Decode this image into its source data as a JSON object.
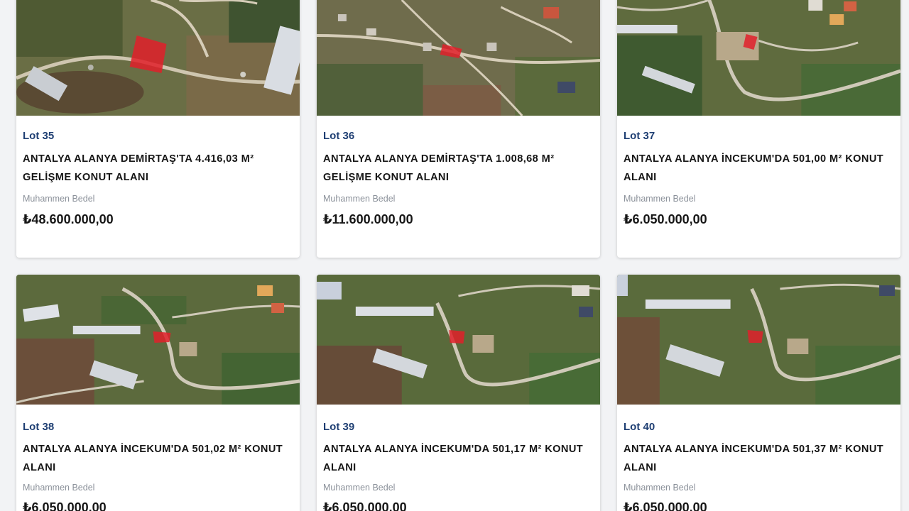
{
  "listings": [
    {
      "lot": "Lot 35",
      "title": "ANTALYA ALANYA DEMİRTAŞ'TA 4.416,03 M² GELİŞME KONUT ALANI",
      "price_label": "Muhammen Bedel",
      "price": "₺48.600.000,00"
    },
    {
      "lot": "Lot 36",
      "title": "ANTALYA ALANYA DEMİRTAŞ'TA 1.008,68 M² GELİŞME KONUT ALANI",
      "price_label": "Muhammen Bedel",
      "price": "₺11.600.000,00"
    },
    {
      "lot": "Lot 37",
      "title": "ANTALYA ALANYA İNCEKUM'DA 501,00 M² KONUT ALANI",
      "price_label": "Muhammen Bedel",
      "price": "₺6.050.000,00"
    },
    {
      "lot": "Lot 38",
      "title": "ANTALYA ALANYA İNCEKUM'DA 501,02 M² KONUT ALANI",
      "price_label": "Muhammen Bedel",
      "price": "₺6.050.000,00"
    },
    {
      "lot": "Lot 39",
      "title": "ANTALYA ALANYA İNCEKUM'DA 501,17 M² KONUT ALANI",
      "price_label": "Muhammen Bedel",
      "price": "₺6.050.000,00"
    },
    {
      "lot": "Lot 40",
      "title": "ANTALYA ALANYA İNCEKUM'DA 501,37 M² KONUT ALANI",
      "price_label": "Muhammen Bedel",
      "price": "₺6.050.000,00"
    }
  ],
  "colors": {
    "lot_text": "#1f3f73",
    "title_text": "#161616",
    "label_text": "#8b919a",
    "parcel_highlight": "#e0202a",
    "page_background": "#f2f3f5"
  }
}
